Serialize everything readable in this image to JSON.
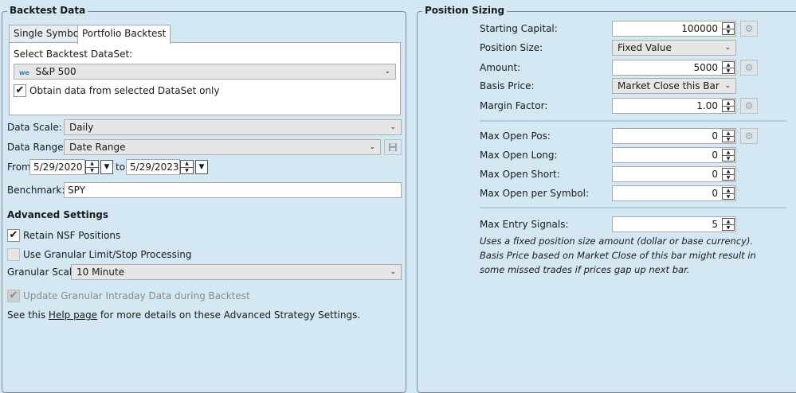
{
  "backtest": {
    "group_title": "Backtest Data",
    "tabs": [
      "Single Symbol",
      "Portfolio Backtest"
    ],
    "select_dataset_label": "Select Backtest DataSet:",
    "dataset_badge": "we",
    "dataset_value": "S&P 500",
    "obtain_only_label": "Obtain data from selected DataSet only",
    "data_scale_label": "Data Scale:",
    "data_scale_value": "Daily",
    "data_range_label": "Data Range:",
    "data_range_value": "Date Range",
    "from_label": "From",
    "from_date": "5/29/2020",
    "to_label": "to",
    "to_date": "5/29/2023",
    "benchmark_label": "Benchmark:",
    "benchmark_value": "SPY",
    "advanced_title": "Advanced Settings",
    "retain_nsf_label": "Retain NSF Positions",
    "granular_processing_label": "Use Granular Limit/Stop Processing",
    "granular_scale_label": "Granular Scale",
    "granular_scale_value": "10 Minute",
    "update_granular_label": "Update Granular Intraday Data during Backtest",
    "help_prefix": "See this ",
    "help_link": "Help page",
    "help_suffix": " for more details on these Advanced Strategy Settings."
  },
  "sizing": {
    "group_title": "Position Sizing",
    "starting_capital_label": "Starting Capital:",
    "starting_capital_value": "100000",
    "position_size_label": "Position Size:",
    "position_size_value": "Fixed Value",
    "amount_label": "Amount:",
    "amount_value": "5000",
    "basis_price_label": "Basis Price:",
    "basis_price_value": "Market Close this Bar",
    "margin_factor_label": "Margin Factor:",
    "margin_factor_value": "1.00",
    "max_open_pos_label": "Max Open Pos:",
    "max_open_pos_value": "0",
    "max_open_long_label": "Max Open Long:",
    "max_open_long_value": "0",
    "max_open_short_label": "Max Open Short:",
    "max_open_short_value": "0",
    "max_open_symbol_label": "Max Open per Symbol:",
    "max_open_symbol_value": "0",
    "max_entry_label": "Max Entry Signals:",
    "max_entry_value": "5",
    "description_1": "Uses a fixed position size amount (dollar or base currency).",
    "description_2": "Basis Price based on Market Close of this bar might result in",
    "description_3": "some missed trades if prices gap up next bar."
  },
  "icons": {
    "check": "✔",
    "chevron": "⌄",
    "gear": "⚙",
    "save": "💾"
  }
}
